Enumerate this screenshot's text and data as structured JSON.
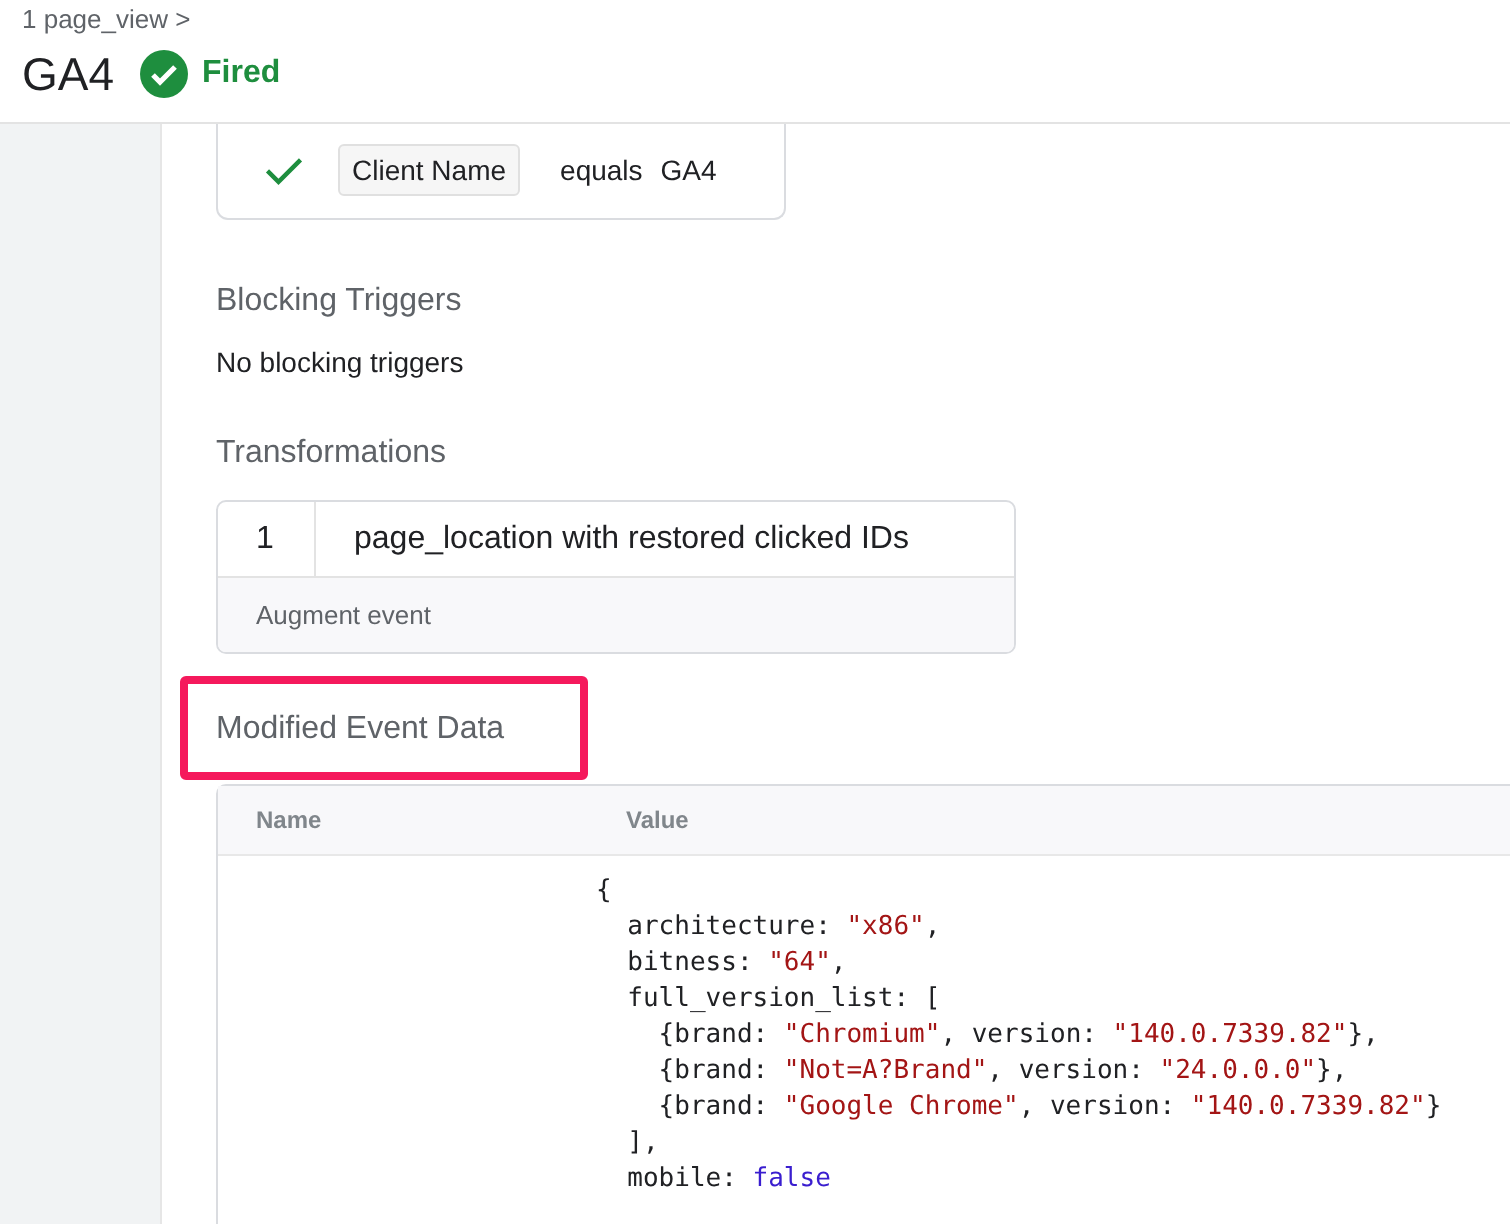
{
  "header": {
    "breadcrumb": "1 page_view >",
    "title": "GA4",
    "status": {
      "kind": "fired",
      "label": "Fired"
    }
  },
  "condition": {
    "met": true,
    "variable": "Client Name",
    "operator": "equals",
    "value": "GA4"
  },
  "blocking_triggers": {
    "heading": "Blocking Triggers",
    "text": "No blocking triggers"
  },
  "transformations": {
    "heading": "Transformations",
    "items": [
      {
        "number": "1",
        "name": "page_location with restored clicked IDs",
        "type": "Augment event"
      }
    ]
  },
  "modified_event_data": {
    "heading": "Modified Event Data",
    "highlighted": true,
    "columns": [
      "Name",
      "Value"
    ],
    "lines": [
      [
        {
          "kind": "punct",
          "text": "{"
        }
      ],
      [
        {
          "kind": "key",
          "text": "  architecture: "
        },
        {
          "kind": "string",
          "text": "\"x86\""
        },
        {
          "kind": "punct",
          "text": ","
        }
      ],
      [
        {
          "kind": "key",
          "text": "  bitness: "
        },
        {
          "kind": "string",
          "text": "\"64\""
        },
        {
          "kind": "punct",
          "text": ","
        }
      ],
      [
        {
          "kind": "key",
          "text": "  full_version_list: ["
        }
      ],
      [
        {
          "kind": "key",
          "text": "    {brand: "
        },
        {
          "kind": "string",
          "text": "\"Chromium\""
        },
        {
          "kind": "key",
          "text": ", version: "
        },
        {
          "kind": "string",
          "text": "\"140.0.7339.82\""
        },
        {
          "kind": "punct",
          "text": "},"
        }
      ],
      [
        {
          "kind": "key",
          "text": "    {brand: "
        },
        {
          "kind": "string",
          "text": "\"Not=A?Brand\""
        },
        {
          "kind": "key",
          "text": ", version: "
        },
        {
          "kind": "string",
          "text": "\"24.0.0.0\""
        },
        {
          "kind": "punct",
          "text": "},"
        }
      ],
      [
        {
          "kind": "key",
          "text": "    {brand: "
        },
        {
          "kind": "string",
          "text": "\"Google Chrome\""
        },
        {
          "kind": "key",
          "text": ", version: "
        },
        {
          "kind": "string",
          "text": "\"140.0.7339.82\""
        },
        {
          "kind": "punct",
          "text": "}"
        }
      ],
      [
        {
          "kind": "punct",
          "text": "  ],"
        }
      ],
      [
        {
          "kind": "key",
          "text": "  mobile: "
        },
        {
          "kind": "keyword",
          "text": "false"
        }
      ]
    ]
  }
}
